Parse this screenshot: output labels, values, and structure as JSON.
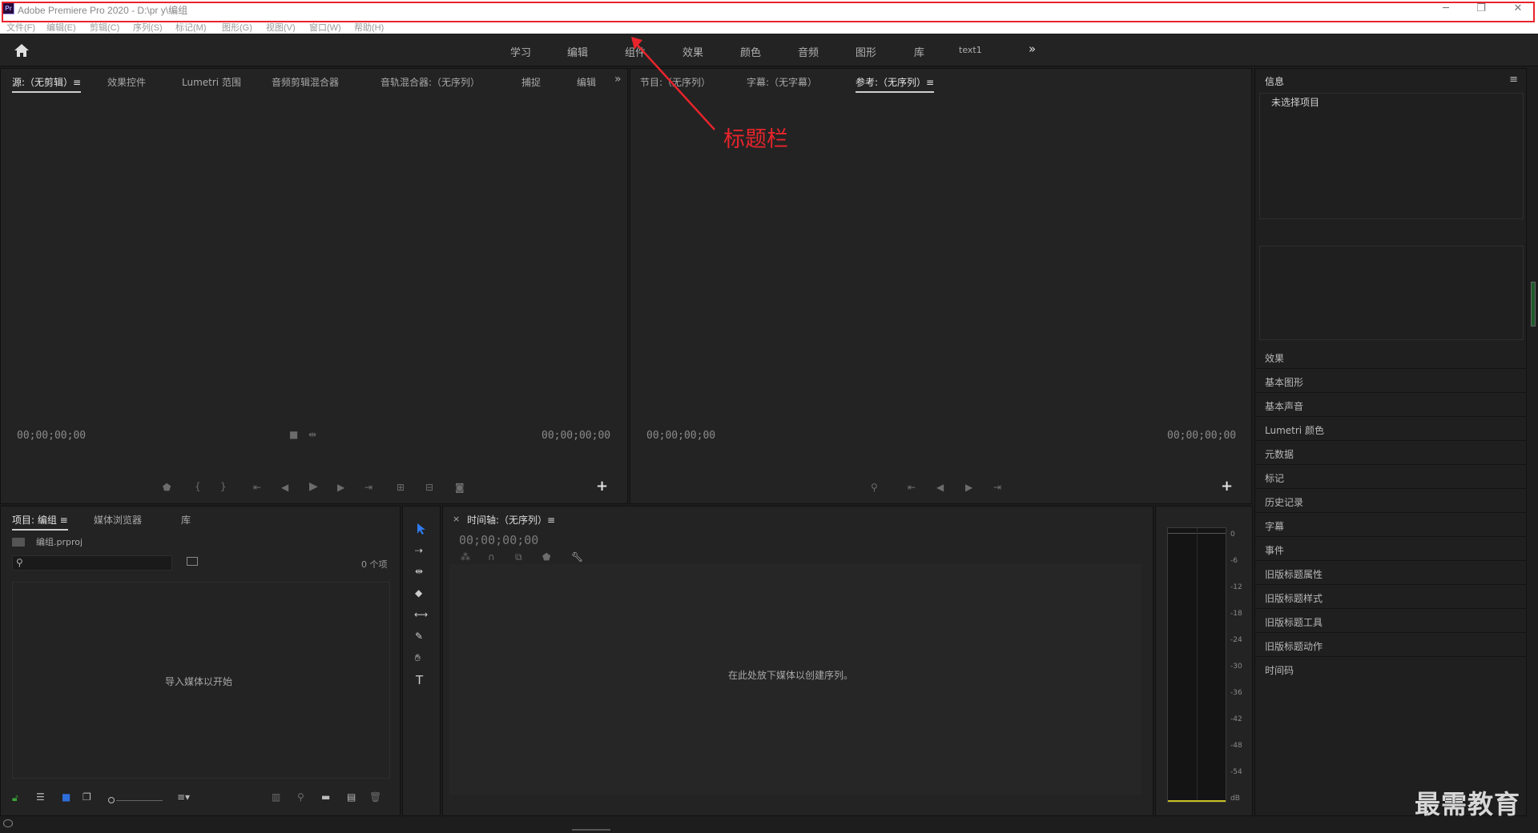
{
  "window": {
    "app_icon": "Pr",
    "title": "Adobe Premiere Pro 2020 - D:\\pr y\\编组",
    "minimize": "─",
    "restore": "❐",
    "close": "✕"
  },
  "menu": [
    "文件(F)",
    "编辑(E)",
    "剪辑(C)",
    "序列(S)",
    "标记(M)",
    "图形(G)",
    "视图(V)",
    "窗口(W)",
    "帮助(H)"
  ],
  "workspaces": [
    "学习",
    "编辑",
    "组件",
    "效果",
    "颜色",
    "音频",
    "图形",
    "库",
    "text1"
  ],
  "workspace_more": "»",
  "source_panel": {
    "tabs": [
      "源:（无剪辑）≡",
      "效果控件",
      "Lumetri 范围",
      "音频剪辑混合器",
      "音轨混合器:（无序列）",
      "捕捉",
      "编辑"
    ],
    "more": "»",
    "timecode_left": "00;00;00;00",
    "timecode_right": "00;00;00;00",
    "add": "+"
  },
  "program_panel": {
    "tabs": [
      "节目:（无序列）",
      "字幕:（无字幕）",
      "参考:（无序列）≡"
    ],
    "timecode_left": "00;00;00;00",
    "timecode_right": "00;00;00;00",
    "add": "+"
  },
  "info_panel": {
    "title": "信息",
    "menu": "≡",
    "no_selection": "未选择项目"
  },
  "right_list": [
    "效果",
    "基本图形",
    "基本声音",
    "Lumetri 颜色",
    "元数据",
    "标记",
    "历史记录",
    "字幕",
    "事件",
    "旧版标题属性",
    "旧版标题样式",
    "旧版标题工具",
    "旧版标题动作",
    "时间码"
  ],
  "project_panel": {
    "tabs": [
      "项目: 编组 ≡",
      "媒体浏览器",
      "库"
    ],
    "project_file": "编组.prproj",
    "item_count": "0 个项",
    "empty_msg": "导入媒体以开始"
  },
  "timeline_panel": {
    "close": "×",
    "title": "时间轴:（无序列）≡",
    "timecode": "00;00;00;00",
    "empty_msg": "在此处放下媒体以创建序列。"
  },
  "audio_meter": {
    "scale": [
      "0",
      "-6",
      "-12",
      "-18",
      "-24",
      "-30",
      "-36",
      "-42",
      "-48",
      "-54",
      "dB"
    ]
  },
  "annotation": {
    "label": "标题栏",
    "color": "#e8242c"
  },
  "watermark": "最需教育"
}
